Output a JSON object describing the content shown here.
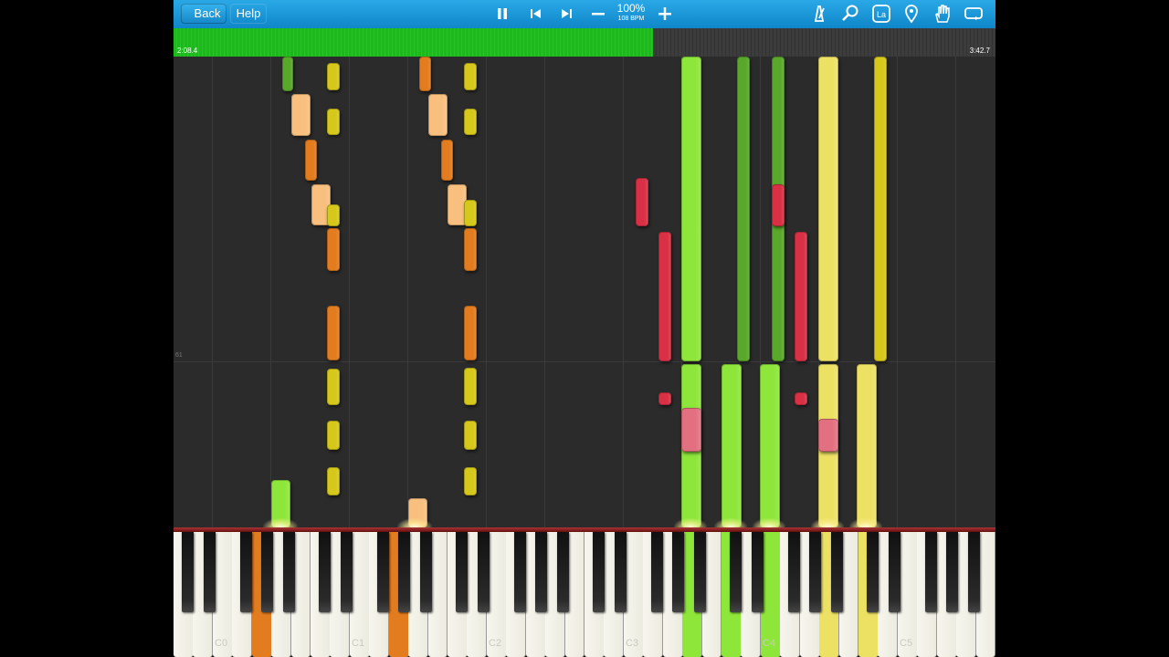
{
  "toolbar": {
    "back_label": "Back",
    "help_label": "Help",
    "tempo_percent": "100%",
    "tempo_bpm": "108 BPM",
    "icons": [
      "pause-icon",
      "rewind-icon",
      "forward-icon",
      "minus-icon",
      "plus-icon",
      "metronome-icon",
      "zoom-icon",
      "label-icon",
      "marker-icon",
      "hand-icon",
      "loop-icon"
    ]
  },
  "progress": {
    "elapsed": "2:08.4",
    "total": "3:42.7",
    "fraction": 0.583,
    "fill_color": "#1cb81c"
  },
  "roll": {
    "measure_number": "61"
  },
  "keyboard": {
    "octave_labels": [
      "C0",
      "C1",
      "C2",
      "C3",
      "C4",
      "C5"
    ]
  },
  "colors": {
    "lh_dark": "#e37c1f",
    "lh_light": "#f8bf7e",
    "lh_yellow": "#d5c81a",
    "rh_green": "#8ee63a",
    "rh_darkgreen": "#5aa82a",
    "rh_red": "#d93045",
    "rh_pink": "#e27080",
    "rh_yellow": "#ede164"
  }
}
